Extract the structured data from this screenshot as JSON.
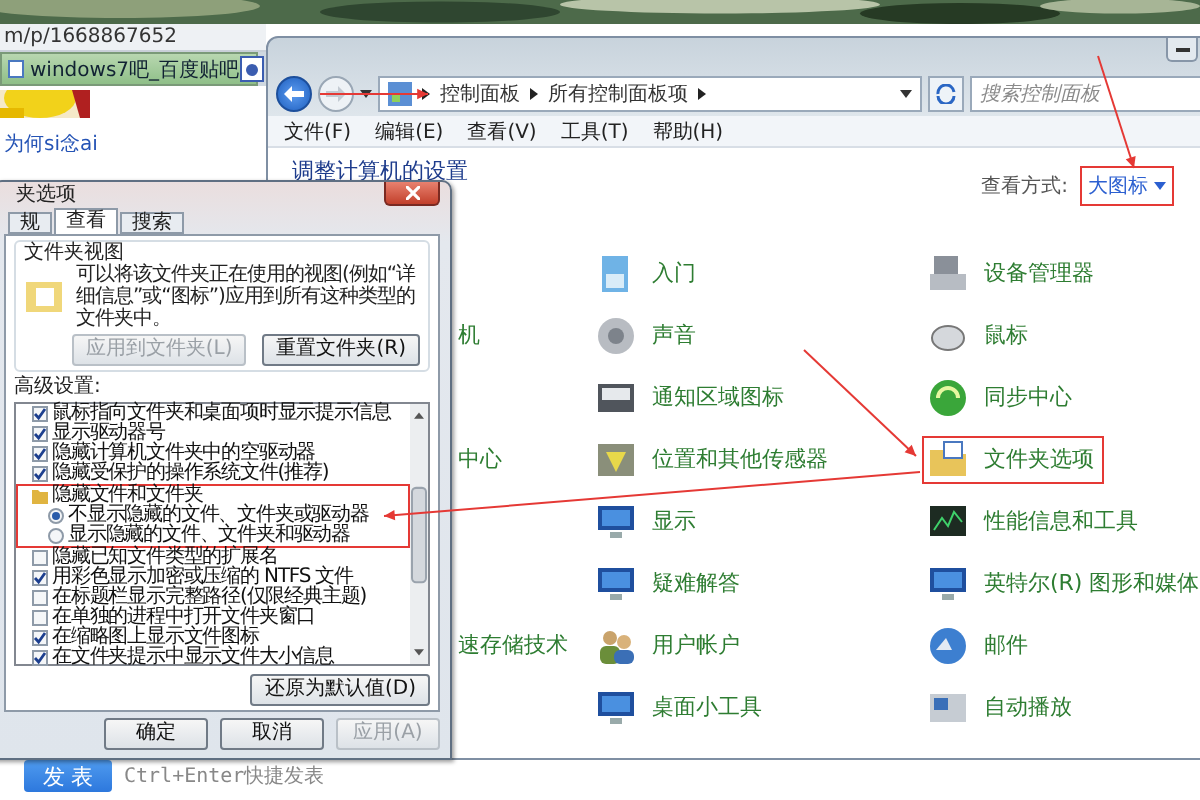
{
  "browser": {
    "address": "m/p/1668867652",
    "tabs": [
      {
        "label": "windows7吧_百度贴吧",
        "selected": true
      }
    ],
    "user_link": "为何si念ai",
    "post_button": "发 表",
    "post_hint": "Ctrl+Enter快捷发表"
  },
  "control_panel": {
    "breadcrumb": [
      "控制面板",
      "所有控制面板项"
    ],
    "search_placeholder": "搜索控制面板",
    "menu": [
      "文件(F)",
      "编辑(E)",
      "查看(V)",
      "工具(T)",
      "帮助(H)"
    ],
    "heading": "调整计算机的设置",
    "view_label": "查看方式:",
    "view_value": {
      "label": "大图标",
      "highlighted": true
    },
    "rows": [
      {
        "middle": {
          "label": "入门",
          "highlighted": false
        },
        "right": {
          "label": "设备管理器",
          "highlighted": false
        }
      },
      {
        "hidden_left": "机",
        "middle": {
          "label": "声音",
          "highlighted": false
        },
        "right": {
          "label": "鼠标",
          "highlighted": false
        }
      },
      {
        "middle": {
          "label": "通知区域图标",
          "highlighted": false
        },
        "right": {
          "label": "同步中心",
          "highlighted": false
        }
      },
      {
        "hidden_left": "中心",
        "middle": {
          "label": "位置和其他传感器",
          "highlighted": false
        },
        "right": {
          "label": "文件夹选项",
          "highlighted": true
        }
      },
      {
        "middle": {
          "label": "显示",
          "highlighted": false
        },
        "right": {
          "label": "性能信息和工具",
          "highlighted": false
        }
      },
      {
        "middle": {
          "label": "疑难解答",
          "highlighted": false
        },
        "right": {
          "label": "英特尔(R) 图形和媒体",
          "highlighted": false
        }
      },
      {
        "hidden_left": "速存储技术",
        "middle": {
          "label": "用户帐户",
          "highlighted": false
        },
        "right": {
          "label": "邮件",
          "highlighted": false
        }
      },
      {
        "middle": {
          "label": "桌面小工具",
          "highlighted": false
        },
        "right": {
          "label": "自动播放",
          "highlighted": false
        }
      }
    ]
  },
  "dialog": {
    "title": "夹选项",
    "tabs": [
      {
        "label": "规",
        "selected": false
      },
      {
        "label": "查看",
        "selected": true
      },
      {
        "label": "搜索",
        "selected": false
      }
    ],
    "group_title": "文件夹视图",
    "group_text": "可以将该文件夹正在使用的视图(例如“详细信息”或“图标”)应用到所有这种类型的文件夹中。",
    "group_buttons": [
      {
        "label": "应用到文件夹(L)",
        "disabled": true
      },
      {
        "label": "重置文件夹(R)",
        "disabled": false
      }
    ],
    "advanced_label": "高级设置:",
    "settings": [
      {
        "kind": "checkbox",
        "label": "鼠标指向文件夹和桌面项时显示提示信息",
        "checked": true
      },
      {
        "kind": "checkbox",
        "label": "显示驱动器号",
        "checked": true
      },
      {
        "kind": "checkbox",
        "label": "隐藏计算机文件夹中的空驱动器",
        "checked": true
      },
      {
        "kind": "checkbox",
        "label": "隐藏受保护的操作系统文件(推荐)",
        "checked": true
      },
      {
        "kind": "folder",
        "label": "隐藏文件和文件夹",
        "highlighted": true,
        "children": [
          {
            "kind": "radio",
            "label": "不显示隐藏的文件、文件夹或驱动器",
            "selected": true
          },
          {
            "kind": "radio",
            "label": "显示隐藏的文件、文件夹和驱动器",
            "selected": false
          }
        ]
      },
      {
        "kind": "checkbox",
        "label": "隐藏已知文件类型的扩展名",
        "checked": false
      },
      {
        "kind": "checkbox",
        "label": "用彩色显示加密或压缩的 NTFS 文件",
        "checked": true
      },
      {
        "kind": "checkbox",
        "label": "在标题栏显示完整路径(仅限经典主题)",
        "checked": false
      },
      {
        "kind": "checkbox",
        "label": "在单独的进程中打开文件夹窗口",
        "checked": false
      },
      {
        "kind": "checkbox",
        "label": "在缩略图上显示文件图标",
        "checked": true
      },
      {
        "kind": "checkbox",
        "label": "在文件夹提示中显示文件大小信息",
        "checked": true
      }
    ],
    "restore_button": "还原为默认值(D)",
    "footer_buttons": [
      {
        "label": "确定",
        "disabled": false
      },
      {
        "label": "取消",
        "disabled": false
      },
      {
        "label": "应用(A)",
        "disabled": true
      }
    ]
  }
}
